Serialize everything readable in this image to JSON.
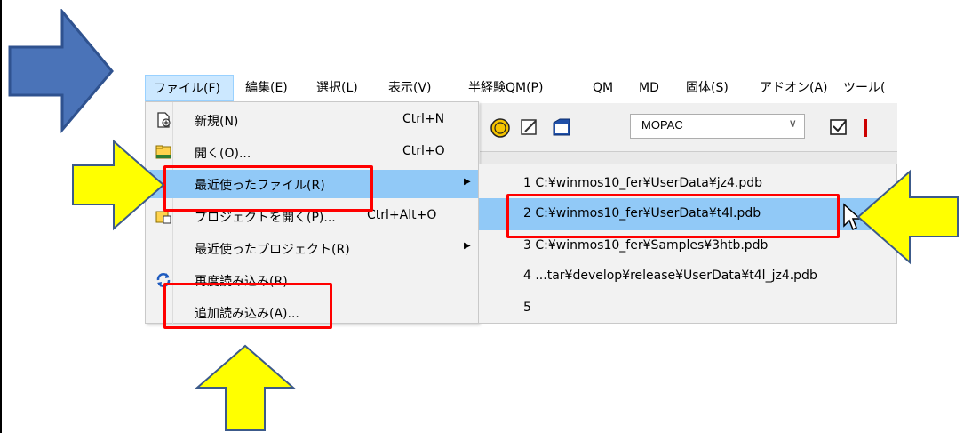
{
  "menubar": {
    "items": [
      "ファイル(F)",
      "編集(E)",
      "選択(L)",
      "表示(V)",
      "半経験QM(P)",
      "QM",
      "MD",
      "固体(S)",
      "アドオン(A)",
      "ツール("
    ]
  },
  "toolbar": {
    "engine_value": "MOPAC",
    "engine_chevron": "∨"
  },
  "file_menu": {
    "items": [
      {
        "label": "新規(N)",
        "shortcut": "Ctrl+N",
        "icon": "new-file-icon"
      },
      {
        "label": "開く(O)...",
        "shortcut": "Ctrl+O",
        "icon": "open-folder-icon"
      },
      {
        "label": "最近使ったファイル(R)",
        "shortcut": "",
        "has_submenu": true
      },
      {
        "label": "プロジェクトを開く(P)...",
        "shortcut": "Ctrl+Alt+O",
        "icon": "project-icon"
      },
      {
        "label": "最近使ったプロジェクト(R)",
        "shortcut": "",
        "has_submenu": true
      },
      {
        "label": "再度読み込み(R)",
        "shortcut": "",
        "icon": "reload-icon"
      },
      {
        "label": "追加読み込み(A)...",
        "shortcut": ""
      }
    ],
    "submenu_arrow": "▶"
  },
  "recent_files": [
    "1 C:¥winmos10_fer¥UserData¥jz4.pdb",
    "2 C:¥winmos10_fer¥UserData¥t4l.pdb",
    "3 C:¥winmos10_fer¥Samples¥3htb.pdb",
    "4 ...tar¥develop¥release¥UserData¥t4l_jz4.pdb",
    "5"
  ],
  "colors": {
    "highlight": "#91c9f7",
    "annotation_red": "#ff0000",
    "arrow_blue": "#4472c4",
    "arrow_yellow": "#ffff00"
  }
}
